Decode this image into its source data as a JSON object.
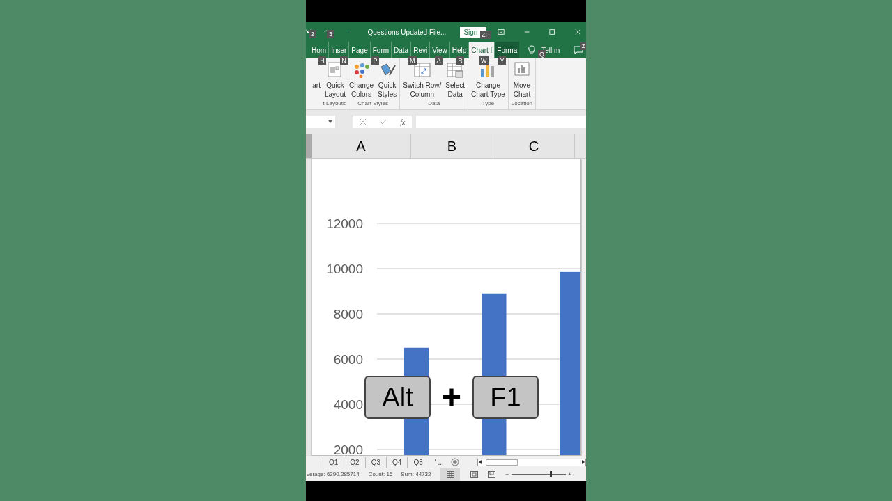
{
  "title_bar": {
    "title": "Questions Updated File...",
    "sign_in": "Sign",
    "customize": "="
  },
  "tabs": [
    {
      "label": "Hom",
      "selected": false,
      "kind": "normal"
    },
    {
      "label": "Inser",
      "selected": false,
      "kind": "normal"
    },
    {
      "label": "Page",
      "selected": false,
      "kind": "normal"
    },
    {
      "label": "Form",
      "selected": false,
      "kind": "normal"
    },
    {
      "label": "Data",
      "selected": false,
      "kind": "normal"
    },
    {
      "label": "Revi",
      "selected": false,
      "kind": "normal"
    },
    {
      "label": "View",
      "selected": false,
      "kind": "normal"
    },
    {
      "label": "Help",
      "selected": false,
      "kind": "normal"
    },
    {
      "label": "Chart I",
      "selected": true,
      "kind": "context"
    },
    {
      "label": "Forma",
      "selected": false,
      "kind": "context"
    }
  ],
  "tell_me": "Tell m",
  "ribbon_groups": [
    {
      "label": "t Layouts",
      "buttons": [
        {
          "label": "art"
        },
        {
          "label": "Quick",
          "sub": "Layout"
        }
      ]
    },
    {
      "label": "Chart Styles",
      "buttons": [
        {
          "label": "Change",
          "sub": "Colors"
        },
        {
          "label": "Quick",
          "sub": "Styles"
        }
      ]
    },
    {
      "label": "Data",
      "buttons": [
        {
          "label": "Switch Row/",
          "sub": "Column"
        },
        {
          "label": "Select",
          "sub": "Data"
        }
      ]
    },
    {
      "label": "Type",
      "buttons": [
        {
          "label": "Change",
          "sub": "Chart Type"
        }
      ]
    },
    {
      "label": "Location",
      "buttons": [
        {
          "label": "Move",
          "sub": "Chart"
        }
      ]
    }
  ],
  "keytips": [
    "2",
    "3",
    "ZP",
    "H",
    "N",
    "P",
    "M",
    "A",
    "R",
    "W",
    "Y",
    "Q",
    "Z"
  ],
  "formula_bar": {
    "fx": "fx"
  },
  "columns": [
    "A",
    "B",
    "C"
  ],
  "chart_data": {
    "type": "bar",
    "grid": true,
    "ylim": [
      2000,
      12000
    ],
    "yticks": [
      2000,
      4000,
      6000,
      8000,
      10000,
      12000
    ],
    "series": [
      {
        "color": "#4472c4",
        "values": [
          6500,
          8900,
          9850
        ]
      }
    ]
  },
  "sheet_tabs": [
    "Q1",
    "Q2",
    "Q3",
    "Q4",
    "Q5",
    "' ..."
  ],
  "status_bar": {
    "average": "verage: 6390.285714",
    "count": "Count: 16",
    "sum": "Sum: 44732",
    "zoom_out": "−",
    "zoom_in": "+",
    "zoom": {
      "level": 0.72
    }
  },
  "shortcut_overlay": {
    "keys": [
      "Alt",
      "F1"
    ],
    "joiner": "+"
  }
}
